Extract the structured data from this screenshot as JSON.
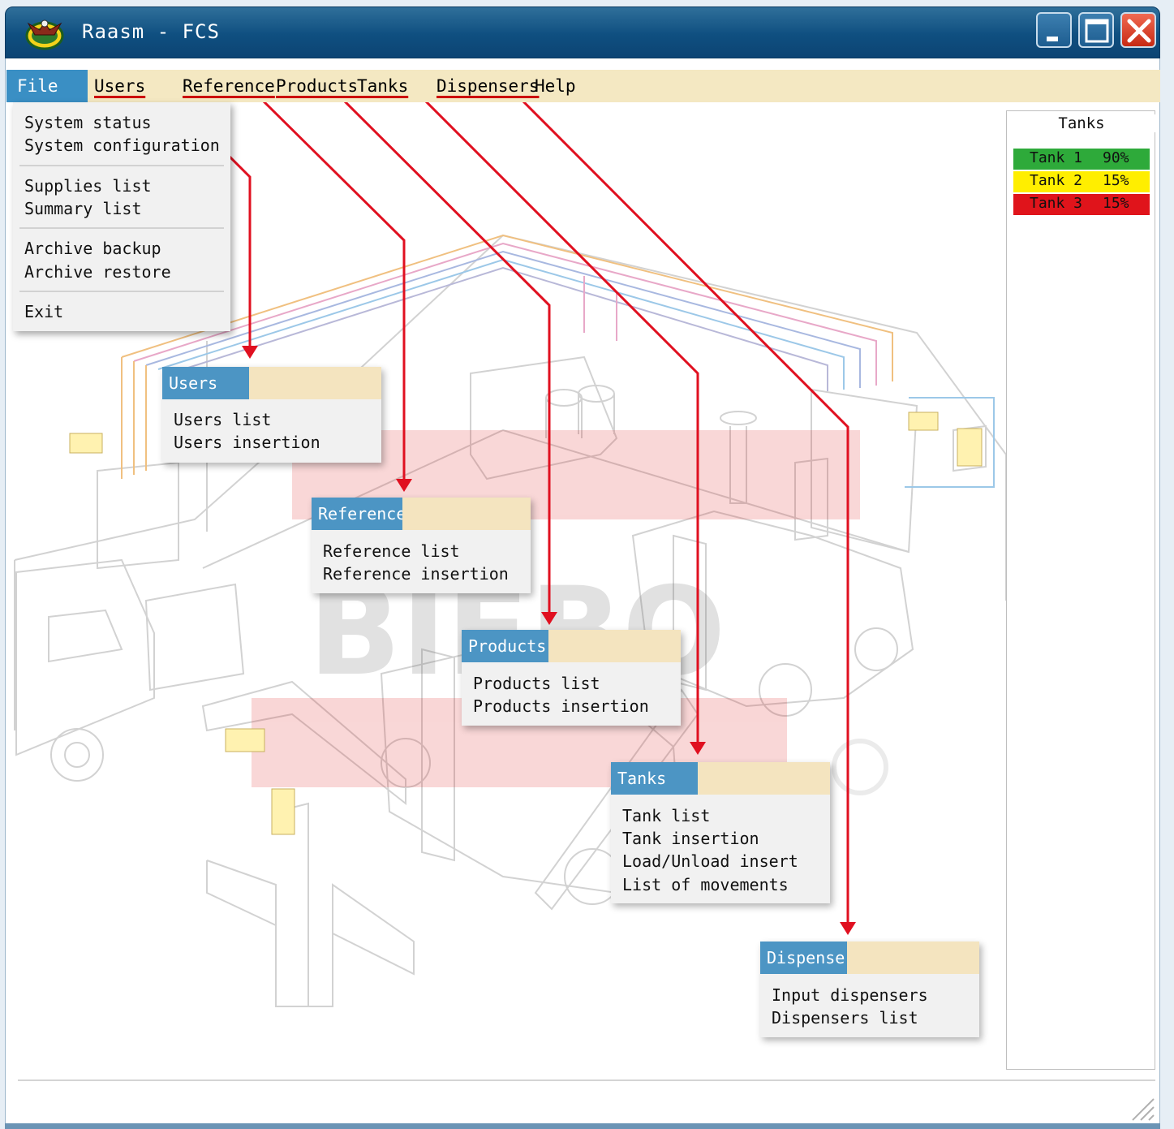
{
  "window": {
    "title": "Raasm - FCS"
  },
  "menubar": {
    "file": "File",
    "users": "Users",
    "reference": "Reference",
    "products": "Products",
    "tanks": "Tanks",
    "dispensers": "Dispensers",
    "help": "Help"
  },
  "file_menu": {
    "items": [
      "System status",
      "System configuration",
      "Supplies list",
      "Summary list",
      "Archive backup",
      "Archive restore",
      "Exit"
    ]
  },
  "submenus": {
    "users": {
      "title": "Users",
      "items": [
        "Users list",
        "Users insertion"
      ]
    },
    "reference": {
      "title": "Reference",
      "items": [
        "Reference list",
        "Reference insertion"
      ]
    },
    "products": {
      "title": "Products",
      "items": [
        "Products list",
        "Products insertion"
      ]
    },
    "tanks": {
      "title": "Tanks",
      "items": [
        "Tank list",
        "Tank insertion",
        "Load/Unload insert",
        "List of movements"
      ]
    },
    "dispensers": {
      "title": "Dispensers",
      "items": [
        "Input dispensers",
        "Dispensers list"
      ]
    }
  },
  "tanks_panel": {
    "title": "Tanks",
    "tanks": [
      {
        "name": "Tank 1",
        "level": "90%",
        "status_color": "#2eaa3a"
      },
      {
        "name": "Tank 2",
        "level": "15%",
        "status_color": "#ffee00"
      },
      {
        "name": "Tank 3",
        "level": "15%",
        "status_color": "#e0141b"
      }
    ]
  },
  "colors": {
    "titlebar": "#0f4f80",
    "menubar": "#f4e8c2",
    "accent_blue": "#4c95c4",
    "connector_red": "#e01020"
  }
}
